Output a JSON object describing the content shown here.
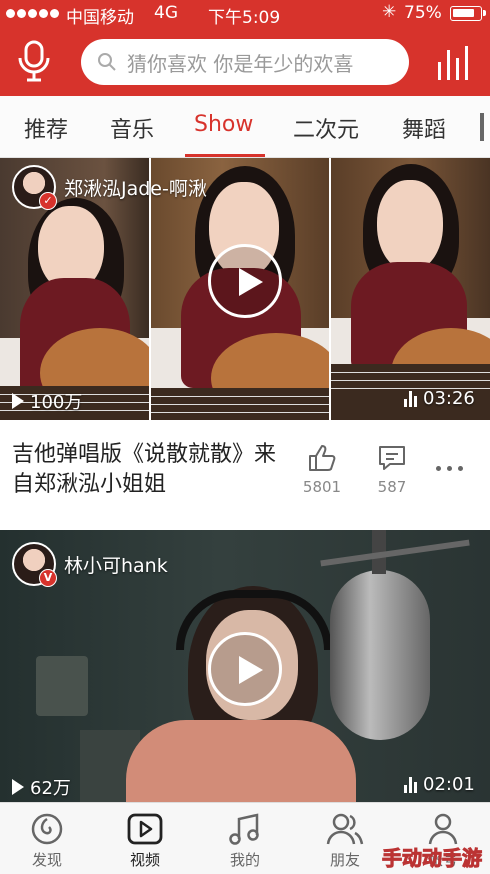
{
  "status_bar": {
    "carrier": "中国移动",
    "network": "4G",
    "time": "下午5:09",
    "battery": "75%"
  },
  "search": {
    "placeholder": "猜你喜欢 你是年少的欢喜"
  },
  "tabs": [
    {
      "label": "推荐",
      "active": false
    },
    {
      "label": "音乐",
      "active": false
    },
    {
      "label": "Show",
      "active": true
    },
    {
      "label": "二次元",
      "active": false
    },
    {
      "label": "舞蹈",
      "active": false
    }
  ],
  "videos": [
    {
      "author": "郑湫泓Jade-啊湫",
      "plays": "100万",
      "duration": "03:26",
      "title": "吉他弹唱版《说散就散》来自郑湫泓小姐姐",
      "likes": "5801",
      "comments": "587"
    },
    {
      "author": "林小可hank",
      "plays": "62万",
      "duration": "02:01"
    }
  ],
  "bottom_nav": [
    {
      "label": "发现",
      "icon": "discover-icon",
      "active": false
    },
    {
      "label": "视频",
      "icon": "video-icon",
      "active": true
    },
    {
      "label": "我的",
      "icon": "music-note-icon",
      "active": false
    },
    {
      "label": "朋友",
      "icon": "friends-icon",
      "active": false
    },
    {
      "label": "帐号",
      "icon": "account-icon",
      "active": false
    }
  ],
  "watermark": "手动动手游",
  "colors": {
    "brand_red": "#d7332c",
    "tab_text": "#333333",
    "muted_text": "#888888"
  }
}
